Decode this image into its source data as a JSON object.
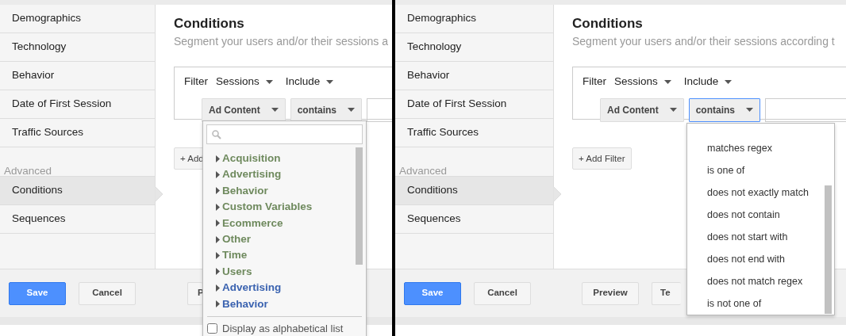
{
  "panels": [
    {
      "sidebar": {
        "items": [
          {
            "label": "Demographics",
            "selected": false
          },
          {
            "label": "Technology",
            "selected": false
          },
          {
            "label": "Behavior",
            "selected": false
          },
          {
            "label": "Date of First Session",
            "selected": false
          },
          {
            "label": "Traffic Sources",
            "selected": false
          }
        ],
        "section_label": "Advanced",
        "advanced_items": [
          {
            "label": "Conditions",
            "selected": true
          },
          {
            "label": "Sequences",
            "selected": false
          }
        ]
      },
      "title": "Conditions",
      "subtitle": "Segment your users and/or their sessions a",
      "filter": {
        "label": "Filter",
        "scope": "Sessions",
        "mode": "Include",
        "dimension": {
          "label": "Ad Content",
          "focused": false
        },
        "operator": {
          "label": "contains",
          "focused": false
        }
      },
      "add_filter": "+ Add",
      "footer_buttons": [
        {
          "label": "Save",
          "kind": "primary"
        },
        {
          "label": "Cancel",
          "kind": "plain"
        },
        {
          "label": "P",
          "kind": "cut"
        }
      ],
      "dropdown": {
        "kind": "dimensions",
        "items": [
          {
            "label": "Acquisition",
            "color": "#6f8a5e"
          },
          {
            "label": "Advertising",
            "color": "#6f8a5e"
          },
          {
            "label": "Behavior",
            "color": "#6f8a5e"
          },
          {
            "label": "Custom Variables",
            "color": "#6f8a5e"
          },
          {
            "label": "Ecommerce",
            "color": "#6f8a5e"
          },
          {
            "label": "Other",
            "color": "#6f8a5e"
          },
          {
            "label": "Time",
            "color": "#6f8a5e"
          },
          {
            "label": "Users",
            "color": "#6f8a5e"
          },
          {
            "label": "Advertising",
            "color": "#3b63b0"
          },
          {
            "label": "Behavior",
            "color": "#3b63b0"
          }
        ],
        "checkbox": {
          "label": "Display as alphabetical list",
          "checked": false
        }
      }
    },
    {
      "sidebar": {
        "items": [
          {
            "label": "Demographics",
            "selected": false
          },
          {
            "label": "Technology",
            "selected": false
          },
          {
            "label": "Behavior",
            "selected": false
          },
          {
            "label": "Date of First Session",
            "selected": false
          },
          {
            "label": "Traffic Sources",
            "selected": false
          }
        ],
        "section_label": "Advanced",
        "advanced_items": [
          {
            "label": "Conditions",
            "selected": true
          },
          {
            "label": "Sequences",
            "selected": false
          }
        ]
      },
      "title": "Conditions",
      "subtitle": "Segment your users and/or their sessions according t",
      "filter": {
        "label": "Filter",
        "scope": "Sessions",
        "mode": "Include",
        "dimension": {
          "label": "Ad Content",
          "focused": false
        },
        "operator": {
          "label": "contains",
          "focused": true
        }
      },
      "add_filter": "+ Add Filter",
      "footer_buttons": [
        {
          "label": "Save",
          "kind": "primary"
        },
        {
          "label": "Cancel",
          "kind": "plain"
        },
        {
          "label": "Preview",
          "kind": "plain"
        },
        {
          "label": "Te",
          "kind": "cut"
        }
      ],
      "dropdown": {
        "kind": "operators",
        "items": [
          {
            "label": "matches regex"
          },
          {
            "label": "is one of"
          },
          {
            "label": "does not exactly match"
          },
          {
            "label": "does not contain"
          },
          {
            "label": "does not start with"
          },
          {
            "label": "does not end with"
          },
          {
            "label": "does not match regex"
          },
          {
            "label": "is not one of"
          }
        ]
      }
    }
  ]
}
